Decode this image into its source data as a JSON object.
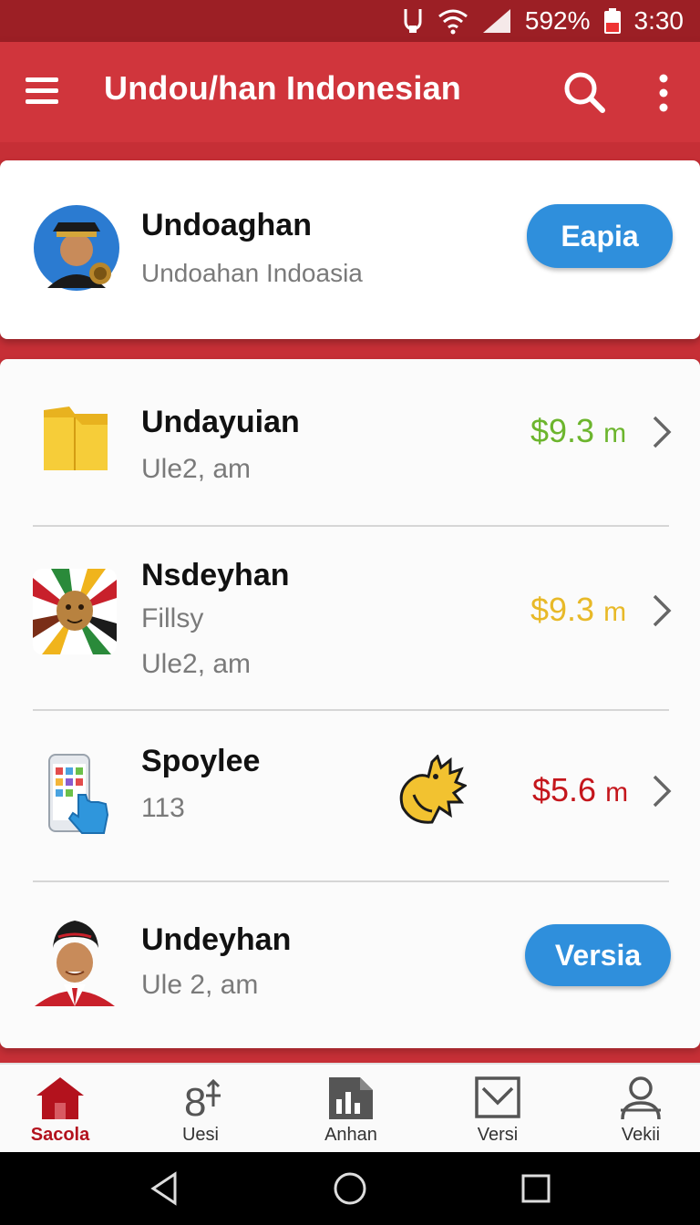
{
  "status_bar": {
    "battery": "592%",
    "time": "3:30"
  },
  "app_bar": {
    "title": "Undou/han Indonesian"
  },
  "profile": {
    "name": "Undoaghan",
    "subtitle": "Undoahan Indoasia",
    "button_label": "Eapia"
  },
  "items": [
    {
      "name": "Undayuian",
      "lines": [
        "Ule2, am"
      ],
      "amount": "$9.3",
      "unit": "m",
      "amount_color": "#6cb52d"
    },
    {
      "name": "Nsdeyhan",
      "lines": [
        "Fillsy",
        "Ule2, am"
      ],
      "amount": "$9.3",
      "unit": "m",
      "amount_color": "#e8b928"
    },
    {
      "name": "Spoylee",
      "lines": [
        "113"
      ],
      "amount": "$5.6",
      "unit": "m",
      "amount_color": "#c4161c"
    },
    {
      "name": "Undeyhan",
      "lines": [
        "Ule 2, am"
      ],
      "button_label": "Versia"
    }
  ],
  "bottom_nav": [
    {
      "label": "Sacola",
      "icon": "home-icon",
      "active": true
    },
    {
      "label": "Uesi",
      "icon": "eight-plus-icon",
      "active": false
    },
    {
      "label": "Anhan",
      "icon": "document-chart-icon",
      "active": false
    },
    {
      "label": "Versi",
      "icon": "check-box-icon",
      "active": false
    },
    {
      "label": "Vekii",
      "icon": "person-icon",
      "active": false
    }
  ],
  "colors": {
    "app_bar": "#d0353c",
    "status_bar": "#9c1f25",
    "accent_button": "#2f8fdc",
    "active_nav": "#b3121d"
  }
}
